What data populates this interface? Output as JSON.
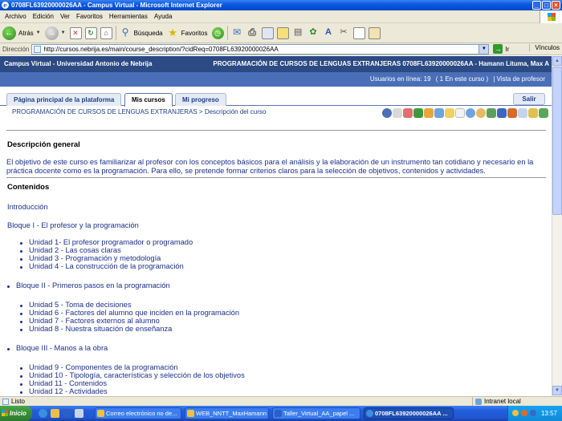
{
  "window": {
    "title": "0708FL63920000026AA - Campus Virtual - Microsoft Internet Explorer",
    "app_icon": "ie-icon"
  },
  "menu": [
    "Archivo",
    "Edición",
    "Ver",
    "Favoritos",
    "Herramientas",
    "Ayuda"
  ],
  "toolbar": {
    "back_label": "Atrás",
    "search_label": "Búsqueda",
    "favorites_label": "Favoritos"
  },
  "address": {
    "label": "Dirección",
    "url": "http://cursos.nebrija.es/main/course_description/?cidReq=0708FL63920000026AA",
    "go_label": "Ir",
    "links_label": "Vínculos"
  },
  "site": {
    "name": "Campus Virtual - Universidad Antonio de Nebrija",
    "course_header": "PROGRAMACIÓN DE CURSOS DE LENGUAS EXTRANJERAS 0708FL63920000026AA - Hamann Lituma, Max A",
    "online_label": "Usuarios en línea: 19",
    "in_course": "( 1 En este curso )",
    "teacher_view": "| Vista de profesor"
  },
  "tabs": [
    {
      "label": "Página principal de la plataforma",
      "active": false
    },
    {
      "label": "Mis cursos",
      "active": true
    },
    {
      "label": "Mi progreso",
      "active": false
    }
  ],
  "logout_label": "Salir",
  "breadcrumb": "PROGRAMACIÓN DE CURSOS DE LENGUAS EXTRANJERAS > Descripción del curso",
  "content": {
    "general_heading": "Descripción general",
    "general_text": "El objetivo de este curso es familiarizar al profesor con los conceptos básicos para el análisis y la elaboración de un instrumento tan cotidiano y necesario en la práctica docente como es la programación. Para ello, se pretende formar criterios claros para la selección de objetivos, contenidos y actividades.",
    "contents_heading": "Contenidos",
    "intro": "Introducción",
    "block1": "Bloque I - El profesor y la programación",
    "block1_units": [
      "Unidad 1- El profesor programador o programado",
      "Unidad 2 - Las cosas claras",
      "Unidad 3 - Programación y metodología",
      "Unidad 4 - La construcción de la programación"
    ],
    "block2": "Bloque II - Primeros pasos en la programación",
    "block2_units": [
      "Unidad 5 - Toma de decisiones",
      "Unidad 6 - Factores del alumno que inciden en la programación",
      "Unidad 7 - Factores externos al alumno",
      "Unidad 8 - Nuestra situación de enseñanza"
    ],
    "block3": "Bloque III - Manos a la obra",
    "block3_units": [
      "Unidad 9 - Componentes de la programación",
      "Unidad 10 - Tipología, características y selección de los objetivos",
      "Unidad 11 - Contenidos",
      "Unidad 12 - Actividades"
    ]
  },
  "statusbar": {
    "status": "Listo",
    "zone": "Intranet local"
  },
  "taskbar": {
    "start_label": "Inicio",
    "tasks": [
      "Correo electrónico no de...",
      "WEB_NNTT_MaxHamann",
      "Taller_Virtual_AA_papel ...",
      "0708FL63920000026AA ..."
    ],
    "clock": "13:57"
  },
  "colors": {
    "header_bg": "#2c4a83",
    "subheader_bg": "#4a6fb8",
    "link": "#1c2e8c"
  }
}
